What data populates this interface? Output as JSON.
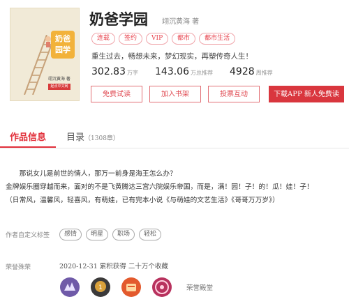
{
  "book": {
    "title": "奶爸学园",
    "author": "翊沉黄海 著",
    "cover": {
      "title_line1": "奶爸",
      "title_line2": "园学",
      "author_mark": "翊沉黄海 著",
      "badge": "起点中文网"
    },
    "tags": [
      "连载",
      "签约",
      "VIP",
      "都市",
      "都市生活"
    ],
    "slogan": "重生过去，畅想未来，梦幻现实，再塑传奇人生！",
    "stats": [
      {
        "value": "302.83",
        "unit": "万字"
      },
      {
        "value": "143.06",
        "unit": "万总推荐"
      },
      {
        "value": "4928",
        "unit": "周推荐"
      }
    ]
  },
  "actions": {
    "free_trial": "免费试读",
    "add_shelf": "加入书架",
    "vote": "投票互动",
    "download": "下载APP 新人免费读"
  },
  "tabs": {
    "info": "作品信息",
    "catalog": "目录",
    "catalog_count": "（1308章）"
  },
  "intro": [
    "　　那说女儿是前世的情人，那万一前身是海王怎么办？",
    "金牌娱乐圈穿越而来，面对的不是飞黄腾达三宫六院娱乐帝国，而是，满！园！子！的！瓜！娃！子！",
    "（日常风，温馨风，轻喜风，有萌娃，已有完本小说《与萌娃的文艺生活》《哥哥万万岁》）"
  ],
  "keywords": {
    "label": "作者自定义标签",
    "items": [
      "感情",
      "明星",
      "职场",
      "轻松"
    ]
  },
  "honors": {
    "label": "荣誉殊荣",
    "line": "2020-12-31  累积获得 二十万个收藏",
    "link": "荣誉殿堂"
  },
  "colors": {
    "accent": "#e2303b",
    "download_bg": "#d9363e",
    "medals": [
      "#6f5aa8",
      "#3b3a3a",
      "#e35a2d",
      "#b8325e"
    ]
  }
}
